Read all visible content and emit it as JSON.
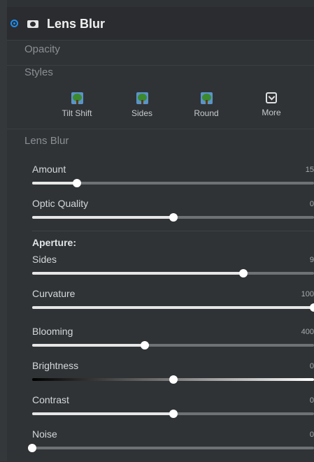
{
  "header": {
    "title": "Lens Blur"
  },
  "sections": {
    "opacity": "Opacity",
    "styles": "Styles",
    "lens_blur": "Lens Blur"
  },
  "styles": [
    {
      "label": "Tilt Shift",
      "icon": "tree-icon"
    },
    {
      "label": "Sides",
      "icon": "tree-icon"
    },
    {
      "label": "Round",
      "icon": "tree-icon"
    },
    {
      "label": "More",
      "icon": "chevron-down-box-icon"
    }
  ],
  "aperture_label": "Aperture:",
  "sliders": {
    "amount": {
      "label": "Amount",
      "value": "15",
      "fraction": 0.16
    },
    "optic_quality": {
      "label": "Optic Quality",
      "value": "0",
      "fraction": 0.5
    },
    "sides": {
      "label": "Sides",
      "value": "9",
      "fraction": 0.75
    },
    "curvature": {
      "label": "Curvature",
      "value": "100",
      "fraction": 1.0
    },
    "blooming": {
      "label": "Blooming",
      "value": "400",
      "fraction": 0.4
    },
    "brightness": {
      "label": "Brightness",
      "value": "0",
      "fraction": 0.5
    },
    "contrast": {
      "label": "Contrast",
      "value": "0",
      "fraction": 0.5
    },
    "noise": {
      "label": "Noise",
      "value": "0",
      "fraction": 0.0
    }
  },
  "colors": {
    "accent": "#1e8ef0",
    "background": "#2c2f32",
    "track": "#6f7275",
    "fill": "#e6e6e6"
  }
}
